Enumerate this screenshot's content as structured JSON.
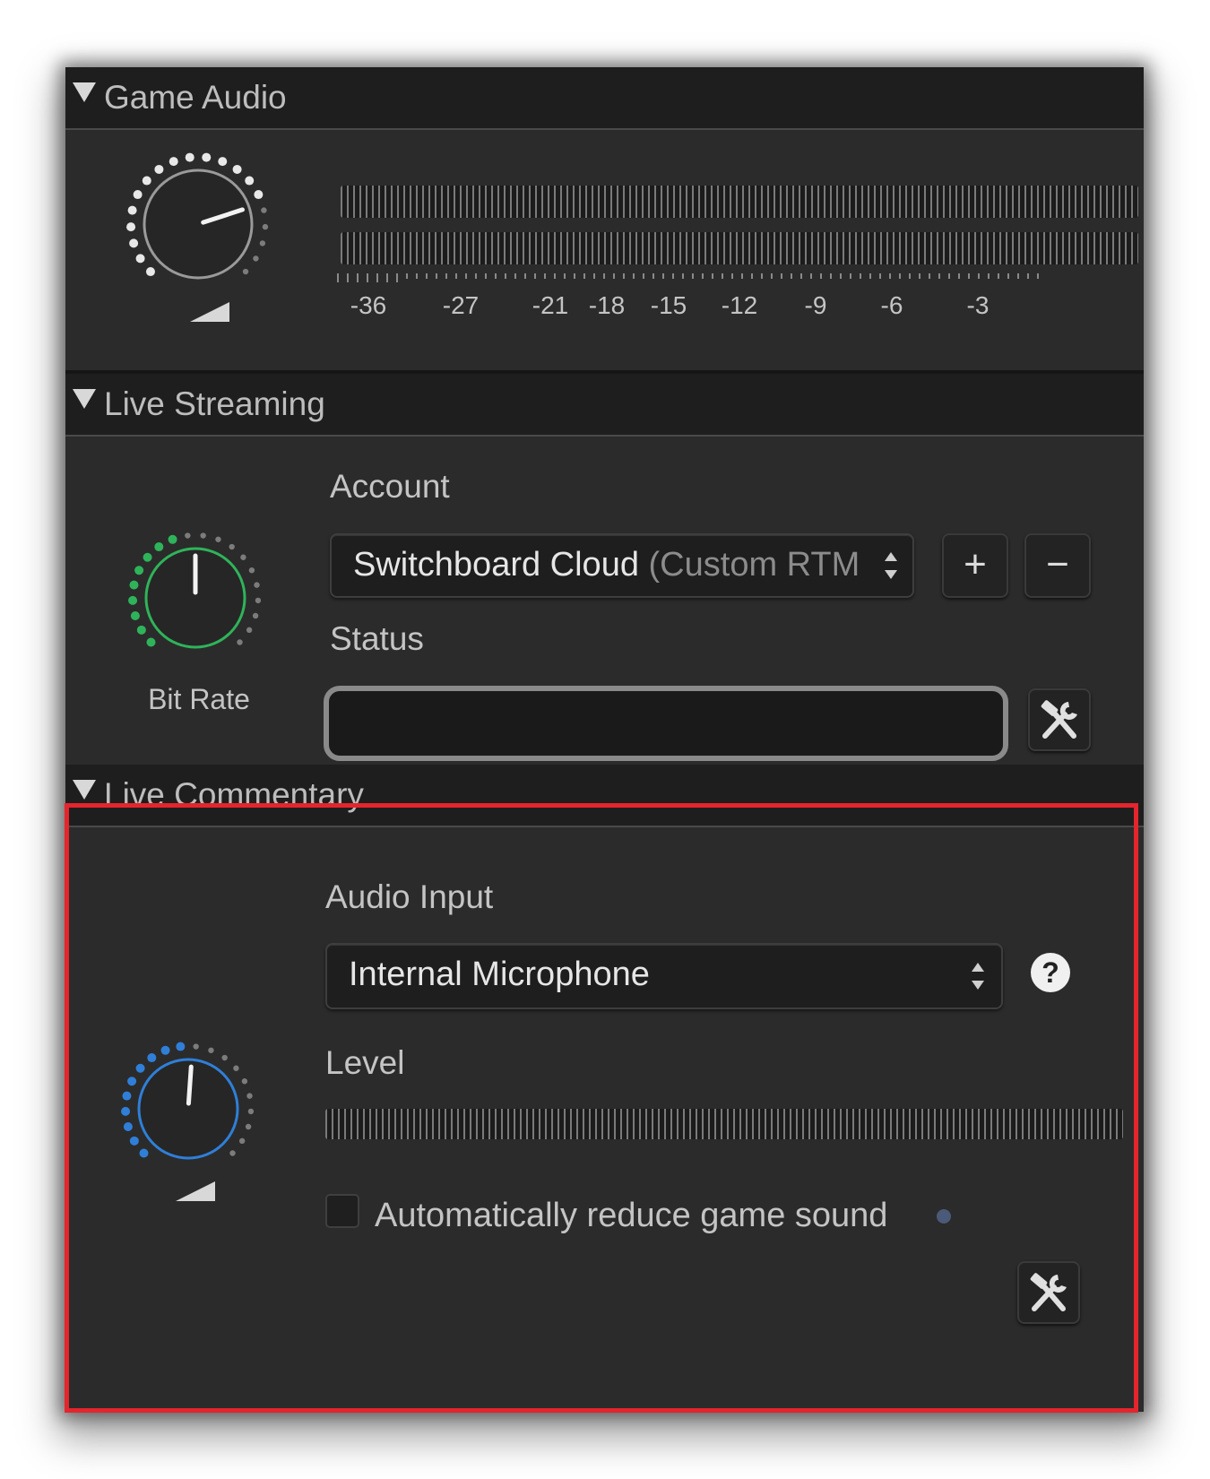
{
  "game_audio": {
    "title": "Game Audio",
    "meter_scale": [
      "-36",
      "-27",
      "-21",
      "-18",
      "-15",
      "-12",
      "-9",
      "-6",
      "-3"
    ]
  },
  "live_streaming": {
    "title": "Live Streaming",
    "account_label": "Account",
    "account_value": "Switchboard Cloud",
    "account_value_dim": "(Custom RTM",
    "add_label": "+",
    "remove_label": "−",
    "status_label": "Status",
    "status_value": "",
    "knob_label": "Bit Rate"
  },
  "live_commentary": {
    "title": "Live Commentary",
    "audio_input_label": "Audio Input",
    "audio_input_value": "Internal Microphone",
    "help_label": "?",
    "level_label": "Level",
    "auto_reduce_label": "Automatically reduce game sound",
    "auto_reduce_checked": false
  },
  "icons": {
    "disclosure": "disclosure-triangle-icon",
    "tools": "hammer-wrench-icon",
    "volume_knob": "volume-knob-icon",
    "bitrate_knob": "bitrate-knob-icon",
    "volume_ramp": "volume-ramp-icon",
    "stepper": "up-down-arrows-icon"
  },
  "colors": {
    "knob_green": "#2fb35a",
    "knob_blue": "#2f7fd8",
    "knob_white": "#e8e8e8",
    "highlight_border": "#e4252d"
  }
}
